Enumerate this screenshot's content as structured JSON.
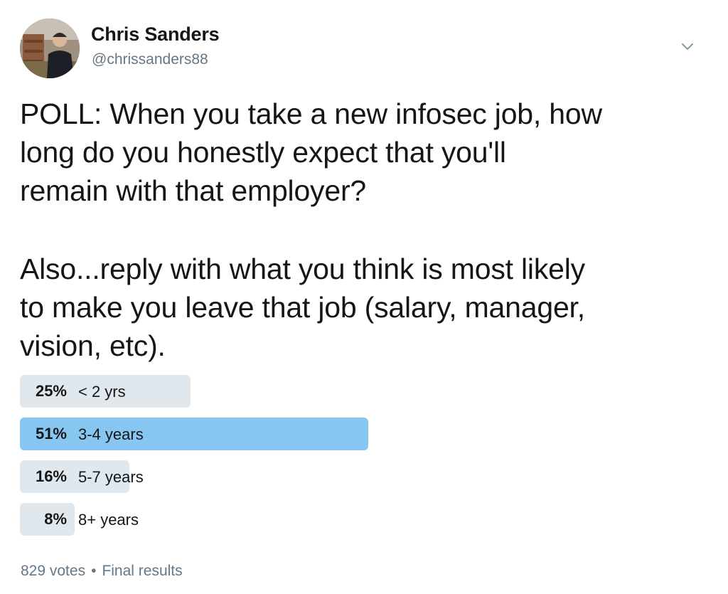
{
  "author": {
    "name": "Chris Sanders",
    "handle": "@chrissanders88"
  },
  "tweet": {
    "paragraph1": "POLL: When you take a new infosec job, how\nlong do you honestly expect that you'll\nremain with that employer?",
    "paragraph2": "Also...reply with what you think is most likely\nto make you leave that job (salary, manager,\nvision, etc)."
  },
  "poll": {
    "options": [
      {
        "percent_label": "25%",
        "label": "< 2 yrs",
        "percent": 25,
        "winner": false
      },
      {
        "percent_label": "51%",
        "label": "3-4 years",
        "percent": 51,
        "winner": true
      },
      {
        "percent_label": "16%",
        "label": "5-7 years",
        "percent": 16,
        "winner": false
      },
      {
        "percent_label": "8%",
        "label": "8+ years",
        "percent": 8,
        "winner": false
      }
    ],
    "votes": "829 votes",
    "separator": "•",
    "status": "Final results"
  },
  "icons": {
    "caret": "chevron-down-icon"
  },
  "colors": {
    "winner_bar": "#88c6f2",
    "bar": "#e1e8ed",
    "secondary_text": "#657786"
  }
}
